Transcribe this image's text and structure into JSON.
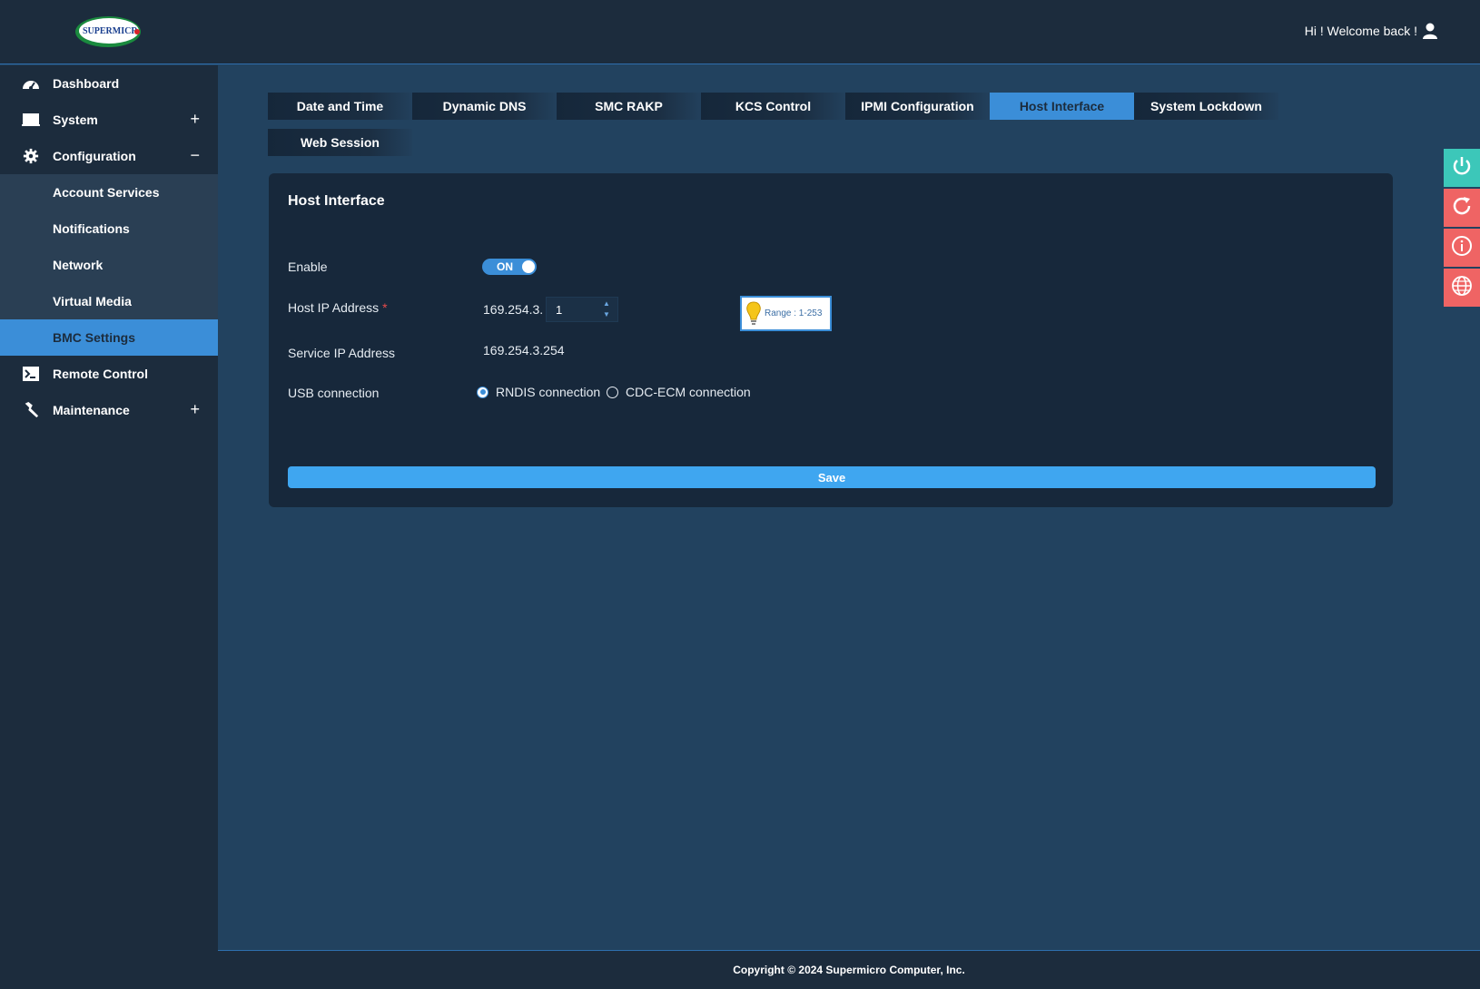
{
  "header": {
    "logo_text": "SUPERMICRO",
    "welcome": "Hi ! Welcome back !"
  },
  "sidebar": {
    "items": [
      {
        "label": "Dashboard",
        "icon": "dashboard-icon"
      },
      {
        "label": "System",
        "icon": "monitor-icon",
        "toggle": "+"
      },
      {
        "label": "Configuration",
        "icon": "gear-icon",
        "toggle": "−"
      },
      {
        "label": "Account Services"
      },
      {
        "label": "Notifications"
      },
      {
        "label": "Network"
      },
      {
        "label": "Virtual Media"
      },
      {
        "label": "BMC Settings",
        "active": true
      },
      {
        "label": "Remote Control",
        "icon": "terminal-icon"
      },
      {
        "label": "Maintenance",
        "icon": "wrench-icon",
        "toggle": "+"
      }
    ]
  },
  "tabs": {
    "items": [
      "Date and Time",
      "Dynamic DNS",
      "SMC RAKP",
      "KCS Control",
      "IPMI Configuration",
      "Host Interface",
      "System Lockdown",
      "Web Session"
    ],
    "active": "Host Interface"
  },
  "panel": {
    "title": "Host Interface",
    "enable_label": "Enable",
    "enable_state": "ON",
    "host_ip_label": "Host IP Address",
    "required_mark": "*",
    "host_ip_prefix": "169.254.3.",
    "host_ip_value": "1",
    "range_hint": "Range : 1-253",
    "service_ip_label": "Service IP Address",
    "service_ip_value": "169.254.3.254",
    "usb_label": "USB connection",
    "usb_options": [
      "RNDIS connection",
      "CDC-ECM connection"
    ],
    "usb_selected": "RNDIS connection",
    "save_label": "Save"
  },
  "side_buttons": [
    {
      "icon": "power-icon",
      "color": "#3cc7b9"
    },
    {
      "icon": "refresh-icon",
      "color": "#ef6464"
    },
    {
      "icon": "info-icon",
      "color": "#ef6464"
    },
    {
      "icon": "globe-icon",
      "color": "#ef6464"
    }
  ],
  "footer": {
    "copyright": "Copyright © 2024 Supermicro Computer, Inc."
  },
  "colors": {
    "accent": "#3b8ed8",
    "header_bg": "#1c2c3d",
    "content_bg": "#22425f",
    "panel_bg": "#17283b"
  }
}
